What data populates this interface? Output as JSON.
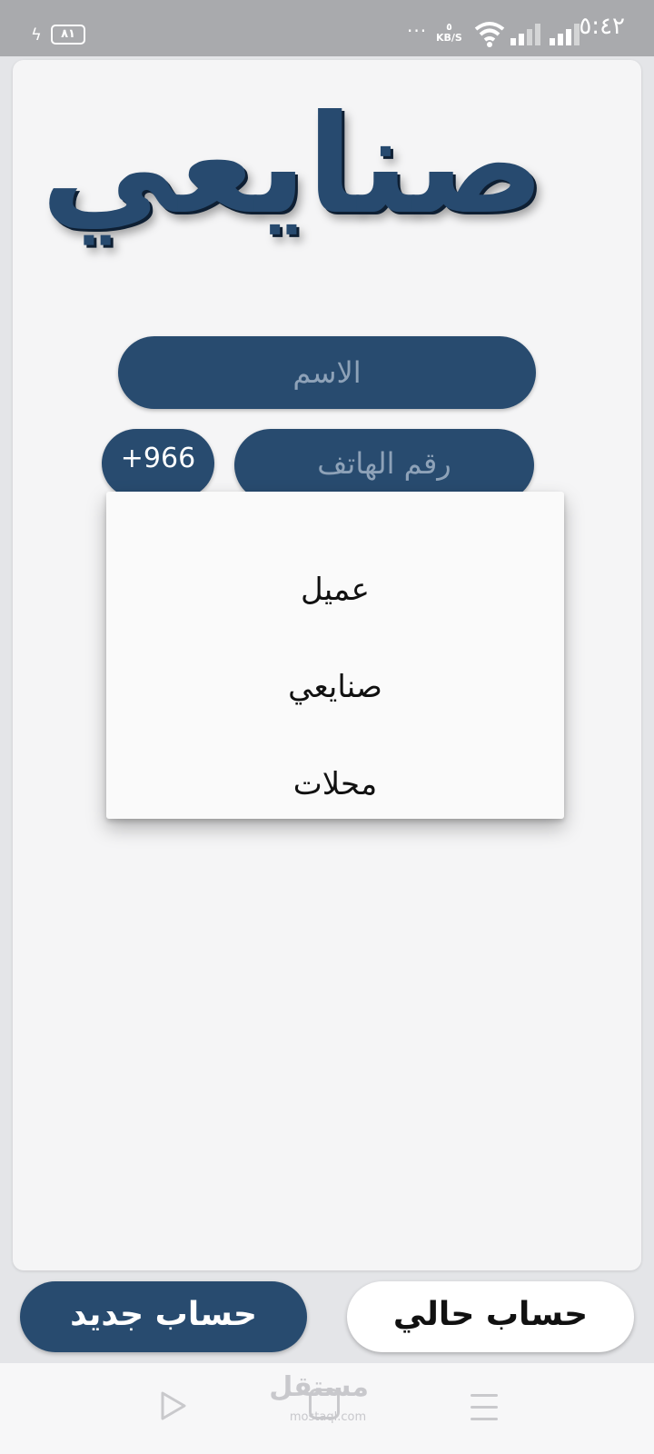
{
  "status_bar": {
    "time": "٥:٤٢",
    "battery": "٨١",
    "net_speed_value": "٥",
    "net_speed_unit": "KB/S",
    "dots": "···"
  },
  "app": {
    "logo_text": "صنايعي"
  },
  "form": {
    "name_placeholder": "الاسم",
    "phone_placeholder": "رقم الهاتف",
    "country_code": "+966"
  },
  "account_type_menu": {
    "options": [
      "عميل",
      "صنايعي",
      "محلات"
    ]
  },
  "buttons": {
    "new_account": "حساب جديد",
    "existing_account": "حساب حالي"
  },
  "nav_bar": {
    "watermark": "مستقل",
    "watermark_url": "mostaql.com"
  },
  "colors": {
    "primary": "#284b6f",
    "card_bg": "#f5f5f6",
    "status_bar_bg": "#a9aaad"
  }
}
